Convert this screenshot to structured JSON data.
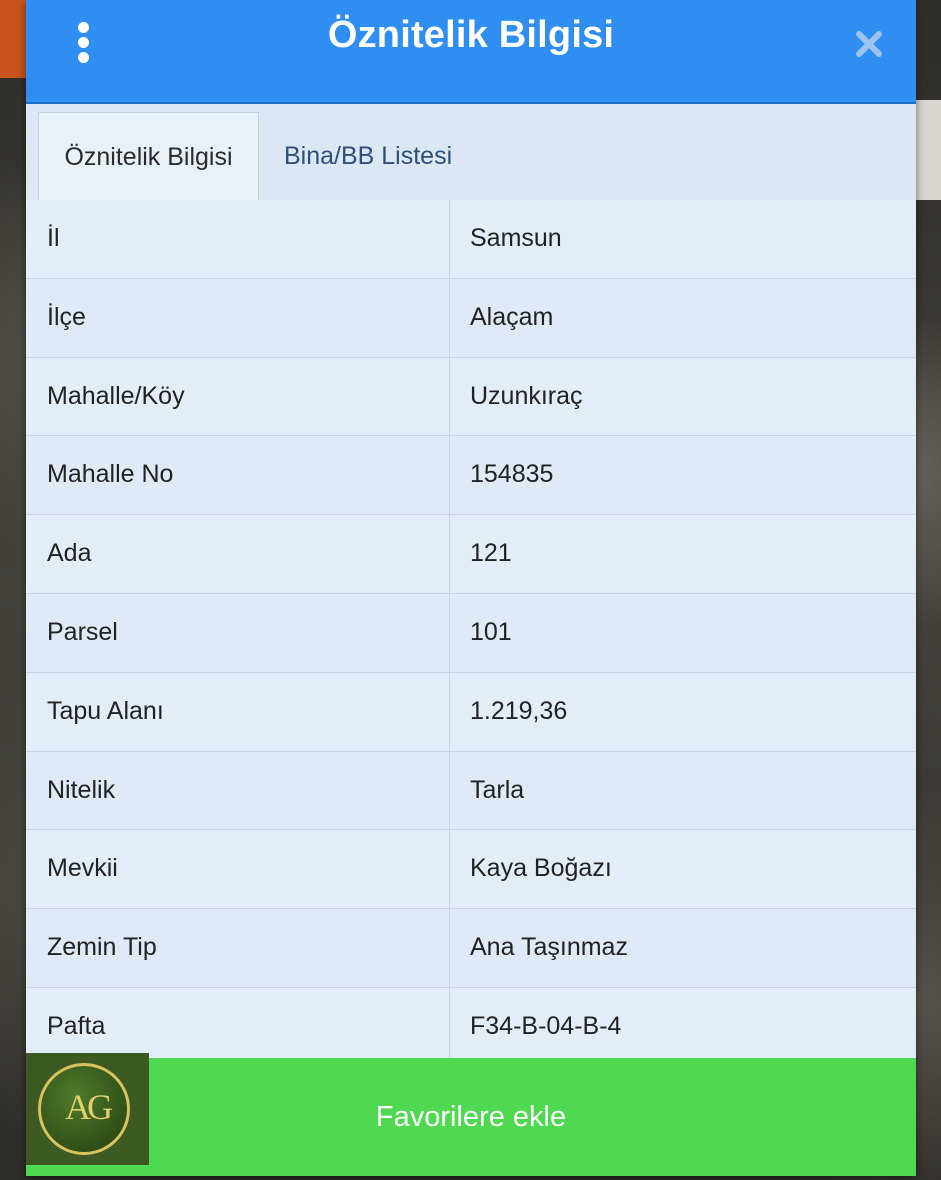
{
  "dialog": {
    "title": "Öznitelik Bilgisi"
  },
  "tabs": [
    {
      "label": "Öznitelik Bilgisi",
      "active": true
    },
    {
      "label": "Bina/BB Listesi",
      "active": false
    }
  ],
  "attributes": [
    {
      "label": "İl",
      "value": "Samsun"
    },
    {
      "label": "İlçe",
      "value": "Alaçam"
    },
    {
      "label": "Mahalle/Köy",
      "value": "Uzunkıraç"
    },
    {
      "label": "Mahalle No",
      "value": "154835"
    },
    {
      "label": "Ada",
      "value": "121"
    },
    {
      "label": "Parsel",
      "value": "101"
    },
    {
      "label": "Tapu Alanı",
      "value": "1.219,36"
    },
    {
      "label": "Nitelik",
      "value": "Tarla"
    },
    {
      "label": "Mevkii",
      "value": "Kaya Boğazı"
    },
    {
      "label": "Zemin Tip",
      "value": "Ana Taşınmaz"
    },
    {
      "label": "Pafta",
      "value": "F34-B-04-B-4"
    }
  ],
  "favorite_button": {
    "label": "Favorilere ekle"
  },
  "logo": {
    "text": "AG"
  },
  "colors": {
    "header": "#2f8ef1",
    "favorite_button": "#4fd951",
    "table_background": "#e2edf8"
  },
  "icons": {
    "menu": "more-vertical-icon",
    "close": "close-icon"
  }
}
